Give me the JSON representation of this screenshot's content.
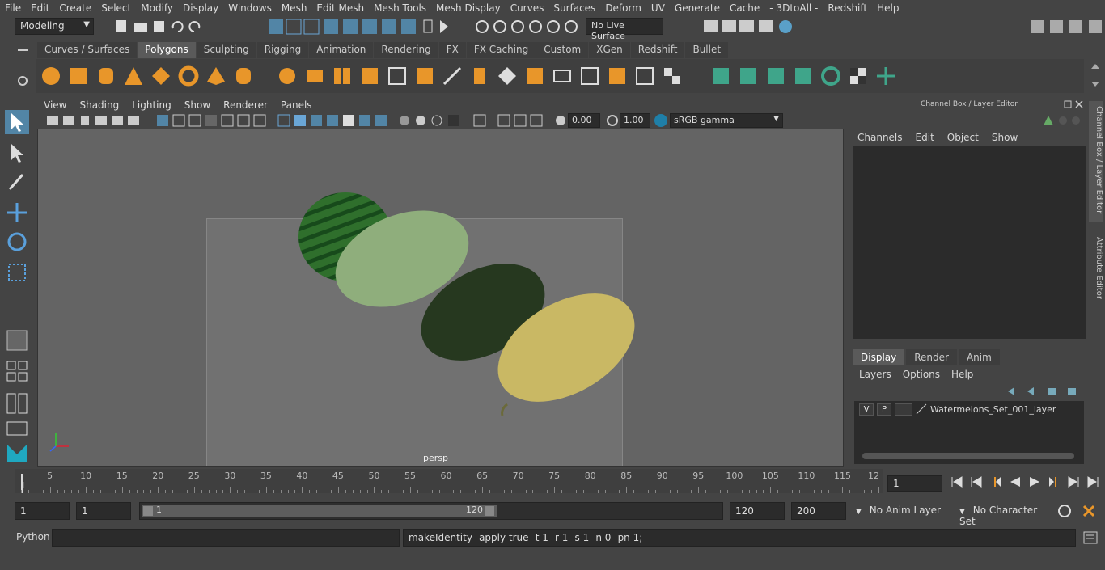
{
  "menu_bar": {
    "items": [
      "File",
      "Edit",
      "Create",
      "Select",
      "Modify",
      "Display",
      "Windows",
      "Mesh",
      "Edit Mesh",
      "Mesh Tools",
      "Mesh Display",
      "Curves",
      "Surfaces",
      "Deform",
      "UV",
      "Generate",
      "Cache",
      "- 3DtoAll -",
      "Redshift",
      "Help"
    ]
  },
  "status_line": {
    "mode": "Modeling",
    "live_surface": "No Live Surface"
  },
  "shelf": {
    "tabs": [
      "Curves / Surfaces",
      "Polygons",
      "Sculpting",
      "Rigging",
      "Animation",
      "Rendering",
      "FX",
      "FX Caching",
      "Custom",
      "XGen",
      "Redshift",
      "Bullet"
    ],
    "active_tab": "Polygons"
  },
  "viewport": {
    "menu": [
      "View",
      "Shading",
      "Lighting",
      "Show",
      "Renderer",
      "Panels"
    ],
    "exposure": "0.00",
    "gamma": "1.00",
    "color_space": "sRGB gamma",
    "camera_label": "persp"
  },
  "channel_box": {
    "title": "Channel Box / Layer Editor",
    "menu": [
      "Channels",
      "Edit",
      "Object",
      "Show"
    ]
  },
  "side_tabs": [
    "Channel Box / Layer Editor",
    "Attribute Editor"
  ],
  "layer_editor": {
    "tabs": [
      "Display",
      "Render",
      "Anim"
    ],
    "active_tab": "Display",
    "menu": [
      "Layers",
      "Options",
      "Help"
    ],
    "layers": [
      {
        "visible": "V",
        "playback": "P",
        "name": "Watermelons_Set_001_layer"
      }
    ]
  },
  "timeline": {
    "ticks": [
      "5",
      "10",
      "15",
      "20",
      "25",
      "30",
      "35",
      "40",
      "45",
      "50",
      "55",
      "60",
      "65",
      "70",
      "75",
      "80",
      "85",
      "90",
      "95",
      "100",
      "105",
      "110",
      "115",
      "12"
    ],
    "start_marker": "1",
    "current_frame": "1"
  },
  "range": {
    "start": "1",
    "playback_start": "1",
    "slider_start": "1",
    "slider_end": "120",
    "playback_end": "120",
    "end": "200",
    "anim_layer": "No Anim Layer",
    "character_set": "No Character Set"
  },
  "command_line": {
    "language": "Python",
    "result": "makeIdentity -apply true -t 1 -r 1 -s 1 -n 0 -pn 1;"
  },
  "colors": {
    "ui_bg": "#444444",
    "field_bg": "#2b2b2b",
    "viewport_bg": "#646464",
    "accent": "#5285a6",
    "shelf_teal": "#3fa58a",
    "shelf_orange": "#e8962a"
  }
}
